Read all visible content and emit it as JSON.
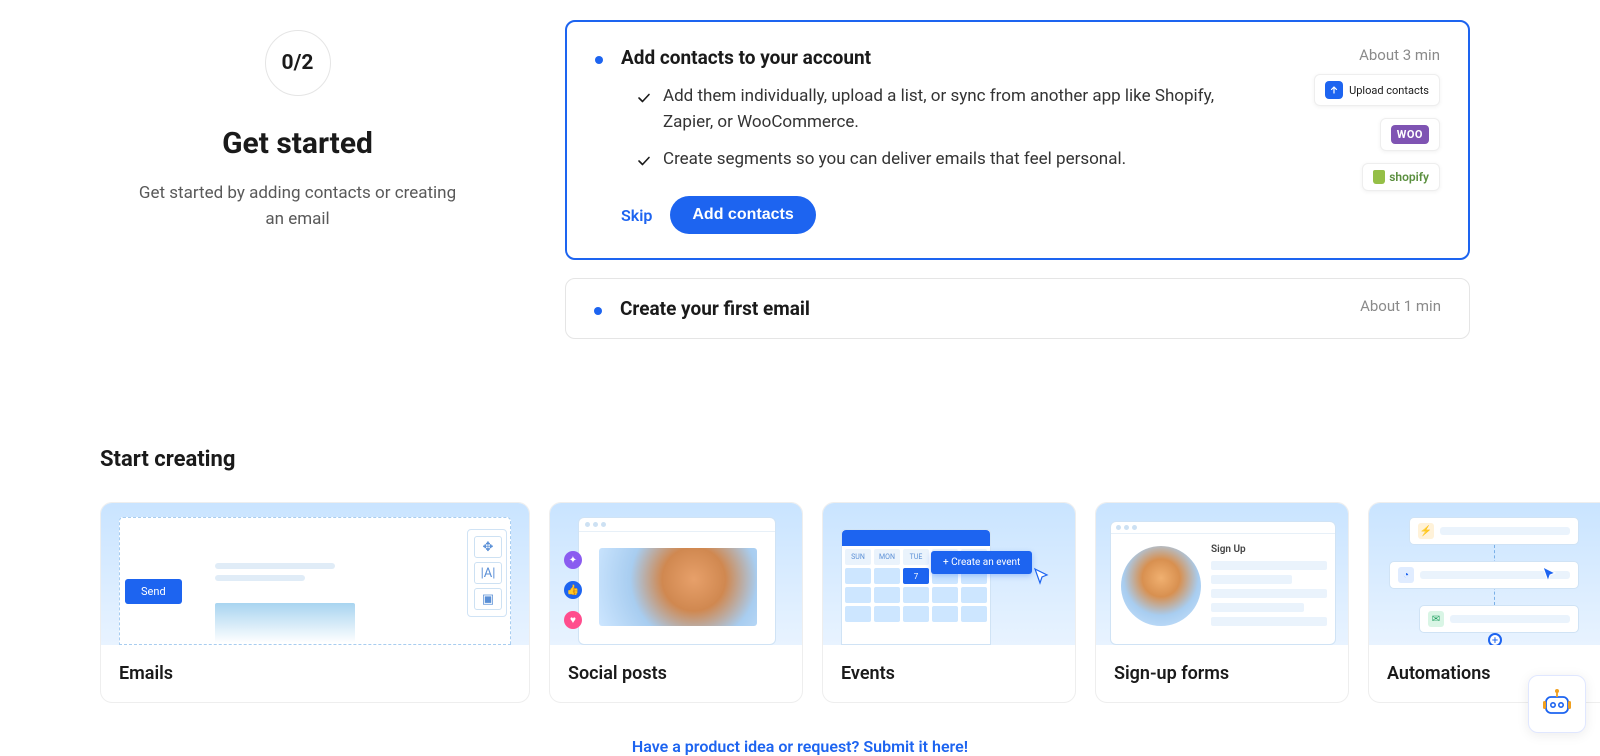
{
  "onboarding": {
    "progress": "0/2",
    "title": "Get started",
    "subtitle": "Get started by adding contacts or creating an email",
    "steps": [
      {
        "title": "Add contacts to your account",
        "time": "About 3 min",
        "desc1": "Add them individually, upload a list, or sync from another app like Shopify, Zapier, or WooCommerce.",
        "desc2": "Create segments so you can deliver emails that feel personal.",
        "skip": "Skip",
        "cta": "Add contacts",
        "integrations": {
          "upload": "Upload contacts",
          "woo": "WOO",
          "shopify": "shopify"
        }
      },
      {
        "title": "Create your first email",
        "time": "About 1 min"
      }
    ]
  },
  "start_creating": {
    "heading": "Start creating",
    "cards": {
      "emails": "Emails",
      "social": "Social posts",
      "events": "Events",
      "signup": "Sign-up forms",
      "automations": "Automations"
    },
    "illustrations": {
      "emails_send": "Send",
      "events_create": "+ Create an event",
      "events_days": [
        "SUN",
        "MON",
        "TUE"
      ],
      "events_date": "7",
      "signup_title": "Sign Up"
    }
  },
  "footer": {
    "product_idea": "Have a product idea or request? Submit it here!"
  }
}
